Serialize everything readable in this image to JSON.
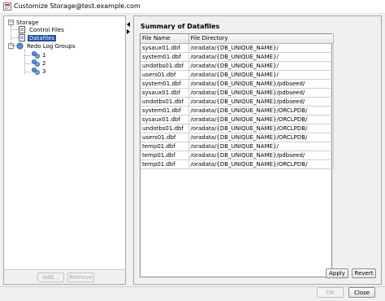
{
  "window": {
    "title": "Customize Storage@test.example.com"
  },
  "tree": {
    "root_label": "Storage",
    "items": [
      {
        "label": "Control Files"
      },
      {
        "label": "Datafiles"
      },
      {
        "label": "Redo Log Groups"
      },
      {
        "label": "1"
      },
      {
        "label": "2"
      },
      {
        "label": "3"
      }
    ]
  },
  "left_buttons": {
    "add": "Add...",
    "remove": "Remove"
  },
  "summary": {
    "title": "Summary of Datafiles",
    "columns": [
      "File Name",
      "File Directory"
    ],
    "rows": [
      [
        "sysaux01.dbf",
        "/oradata/{DB_UNIQUE_NAME}/"
      ],
      [
        "system01.dbf",
        "/oradata/{DB_UNIQUE_NAME}/"
      ],
      [
        "undotbs01.dbf",
        "/oradata/{DB_UNIQUE_NAME}/"
      ],
      [
        "users01.dbf",
        "/oradata/{DB_UNIQUE_NAME}/"
      ],
      [
        "system01.dbf",
        "/oradata/{DB_UNIQUE_NAME}/pdbseed/"
      ],
      [
        "sysaux01.dbf",
        "/oradata/{DB_UNIQUE_NAME}/pdbseed/"
      ],
      [
        "undotbs01.dbf",
        "/oradata/{DB_UNIQUE_NAME}/pdbseed/"
      ],
      [
        "system01.dbf",
        "/oradata/{DB_UNIQUE_NAME}/ORCLPDB/"
      ],
      [
        "sysaux01.dbf",
        "/oradata/{DB_UNIQUE_NAME}/ORCLPDB/"
      ],
      [
        "undotbs01.dbf",
        "/oradata/{DB_UNIQUE_NAME}/ORCLPDB/"
      ],
      [
        "users01.dbf",
        "/oradata/{DB_UNIQUE_NAME}/ORCLPDB/"
      ],
      [
        "temp01.dbf",
        "/oradata/{DB_UNIQUE_NAME}/"
      ],
      [
        "temp01.dbf",
        "/oradata/{DB_UNIQUE_NAME}/pdbseed/"
      ],
      [
        "temp01.dbf",
        "/oradata/{DB_UNIQUE_NAME}/ORCLPDB/"
      ]
    ],
    "apply": "Apply",
    "revert": "Revert"
  },
  "dialog_buttons": {
    "ok": "OK",
    "close": "Close"
  },
  "colors": {
    "selection": "#1f4fa8",
    "background": "#f0f0f0"
  }
}
